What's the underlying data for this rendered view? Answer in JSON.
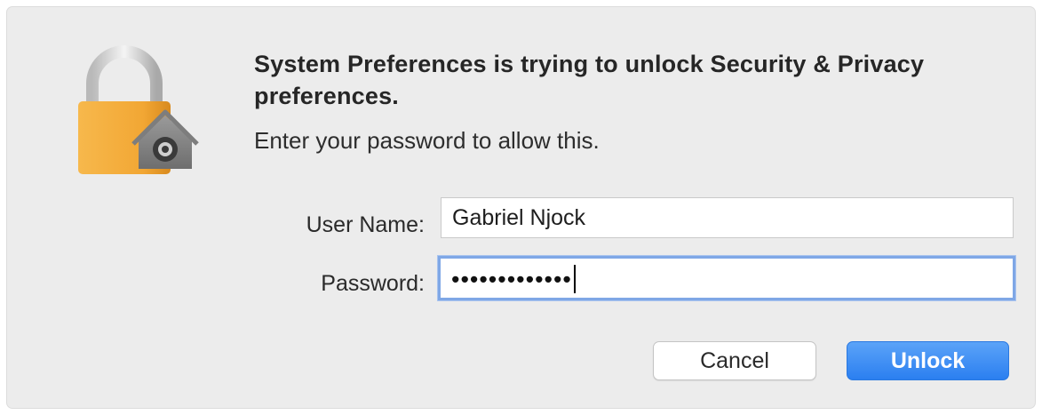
{
  "dialog": {
    "title": "System Preferences is trying to unlock Security & Privacy preferences.",
    "subtitle": "Enter your password to allow this.",
    "icon": "lock-with-gear-icon"
  },
  "fields": {
    "username_label": "User Name:",
    "username_value": "Gabriel Njock",
    "password_label": "Password:",
    "password_masked": "•••••••••••••"
  },
  "buttons": {
    "cancel": "Cancel",
    "unlock": "Unlock"
  },
  "colors": {
    "accent": "#2b7ff0",
    "lock_body": "#f3a83a",
    "focus_ring": "#7fa7e6"
  }
}
